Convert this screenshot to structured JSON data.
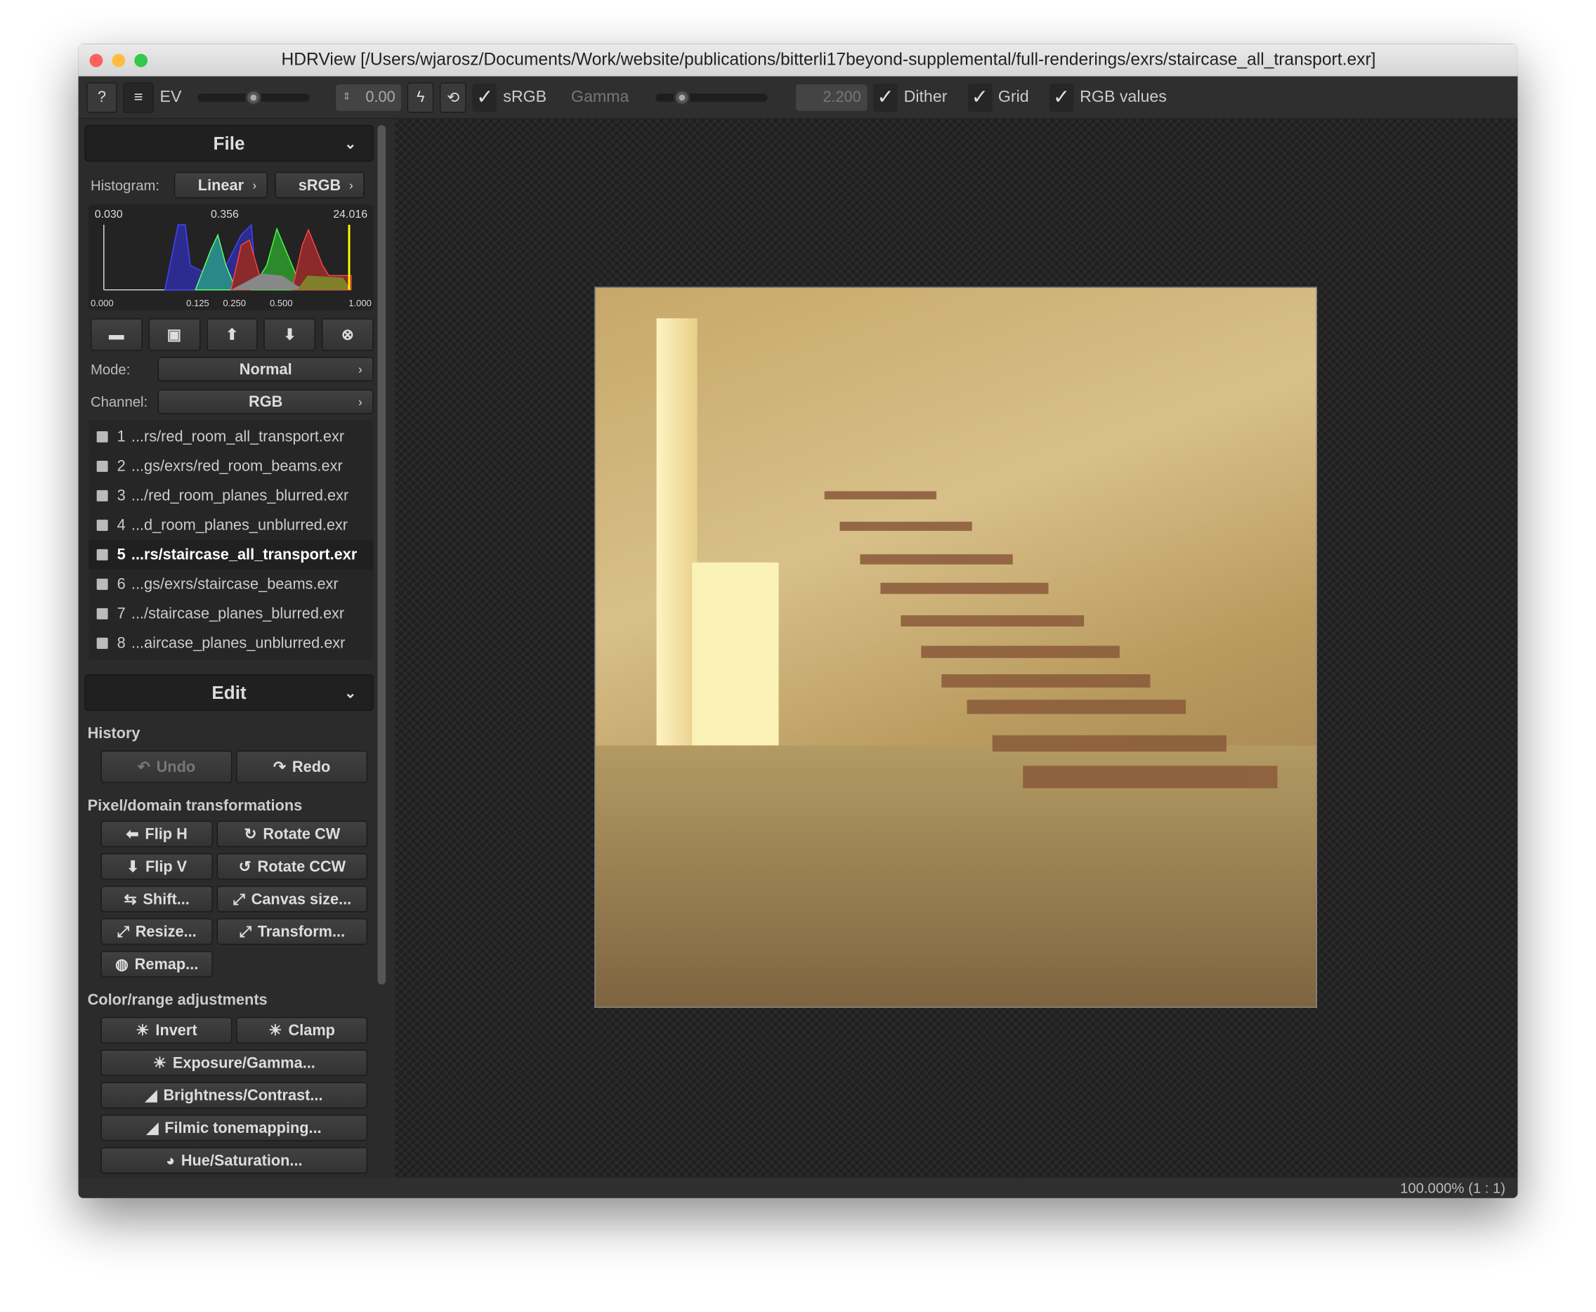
{
  "window": {
    "title": "HDRView [/Users/wjarosz/Documents/Work/website/publications/bitterli17beyond-supplemental/full-renderings/exrs/staircase_all_transport.exr]"
  },
  "toolbar": {
    "help": "?",
    "menu": "≡",
    "ev_label": "EV",
    "ev_value": "0.00",
    "ev_slider": 0.5,
    "srgb_label": "sRGB",
    "srgb_checked": true,
    "gamma_label": "Gamma",
    "gamma_value": "2.200",
    "gamma_slider": 0.25,
    "dither_label": "Dither",
    "grid_label": "Grid",
    "rgb_values_label": "RGB values"
  },
  "file_section": {
    "title": "File",
    "histogram_label": "Histogram:",
    "hist_scale": "Linear",
    "hist_space": "sRGB",
    "hist_min": "0.030",
    "hist_mid": "0.356",
    "hist_max": "24.016",
    "hist_ticks": [
      "0.000",
      "0.125",
      "0.250",
      "0.500",
      "1.000"
    ],
    "mode_label": "Mode:",
    "mode_value": "Normal",
    "channel_label": "Channel:",
    "channel_value": "RGB",
    "files": [
      {
        "n": "1",
        "name": "...rs/red_room_all_transport.exr"
      },
      {
        "n": "2",
        "name": "...gs/exrs/red_room_beams.exr"
      },
      {
        "n": "3",
        "name": ".../red_room_planes_blurred.exr"
      },
      {
        "n": "4",
        "name": "...d_room_planes_unblurred.exr"
      },
      {
        "n": "5",
        "name": "...rs/staircase_all_transport.exr",
        "selected": true
      },
      {
        "n": "6",
        "name": "...gs/exrs/staircase_beams.exr"
      },
      {
        "n": "7",
        "name": ".../staircase_planes_blurred.exr"
      },
      {
        "n": "8",
        "name": "...aircase_planes_unblurred.exr"
      }
    ]
  },
  "edit_section": {
    "title": "Edit",
    "history": "History",
    "undo": "Undo",
    "redo": "Redo",
    "pixel_label": "Pixel/domain transformations",
    "flip_h": "Flip H",
    "rotate_cw": "Rotate CW",
    "flip_v": "Flip V",
    "rotate_ccw": "Rotate CCW",
    "shift": "Shift...",
    "canvas": "Canvas size...",
    "resize": "Resize...",
    "transform": "Transform...",
    "remap": "Remap...",
    "color_label": "Color/range adjustments",
    "invert": "Invert",
    "clamp": "Clamp",
    "exposure": "Exposure/Gamma...",
    "brightness": "Brightness/Contrast...",
    "filmic": "Filmic tonemapping...",
    "hue": "Hue/Saturation..."
  },
  "status": {
    "zoom": "100.000% (1 : 1)"
  }
}
